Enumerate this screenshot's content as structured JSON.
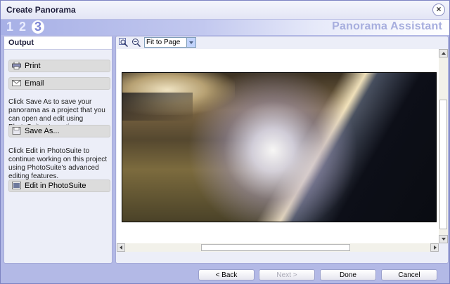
{
  "window": {
    "title": "Create Panorama",
    "close_label": "×"
  },
  "steps": {
    "step1": "1",
    "step2": "2",
    "step3": "3",
    "assistant_title": "Panorama Assistant"
  },
  "left_panel": {
    "header": "Output",
    "print_label": "Print",
    "email_label": "Email",
    "save_text": "Click Save As to save your panorama as a project that you can open and edit using PhotoSuite at any time.",
    "save_as_label": "Save As...",
    "edit_text": "Click Edit in PhotoSuite to continue working on this project using PhotoSuite's advanced editing features.",
    "edit_label": "Edit in PhotoSuite"
  },
  "toolbar": {
    "zoom_value": "Fit to Page"
  },
  "footer": {
    "back_label": "< Back",
    "next_label": "Next >",
    "done_label": "Done",
    "cancel_label": "Cancel"
  },
  "icons": {
    "close": "close-icon",
    "print": "printer-icon",
    "email": "envelope-icon",
    "save": "disk-icon",
    "edit": "edit-icon",
    "zoom_in": "zoom-in-icon",
    "zoom_out": "zoom-out-icon"
  }
}
